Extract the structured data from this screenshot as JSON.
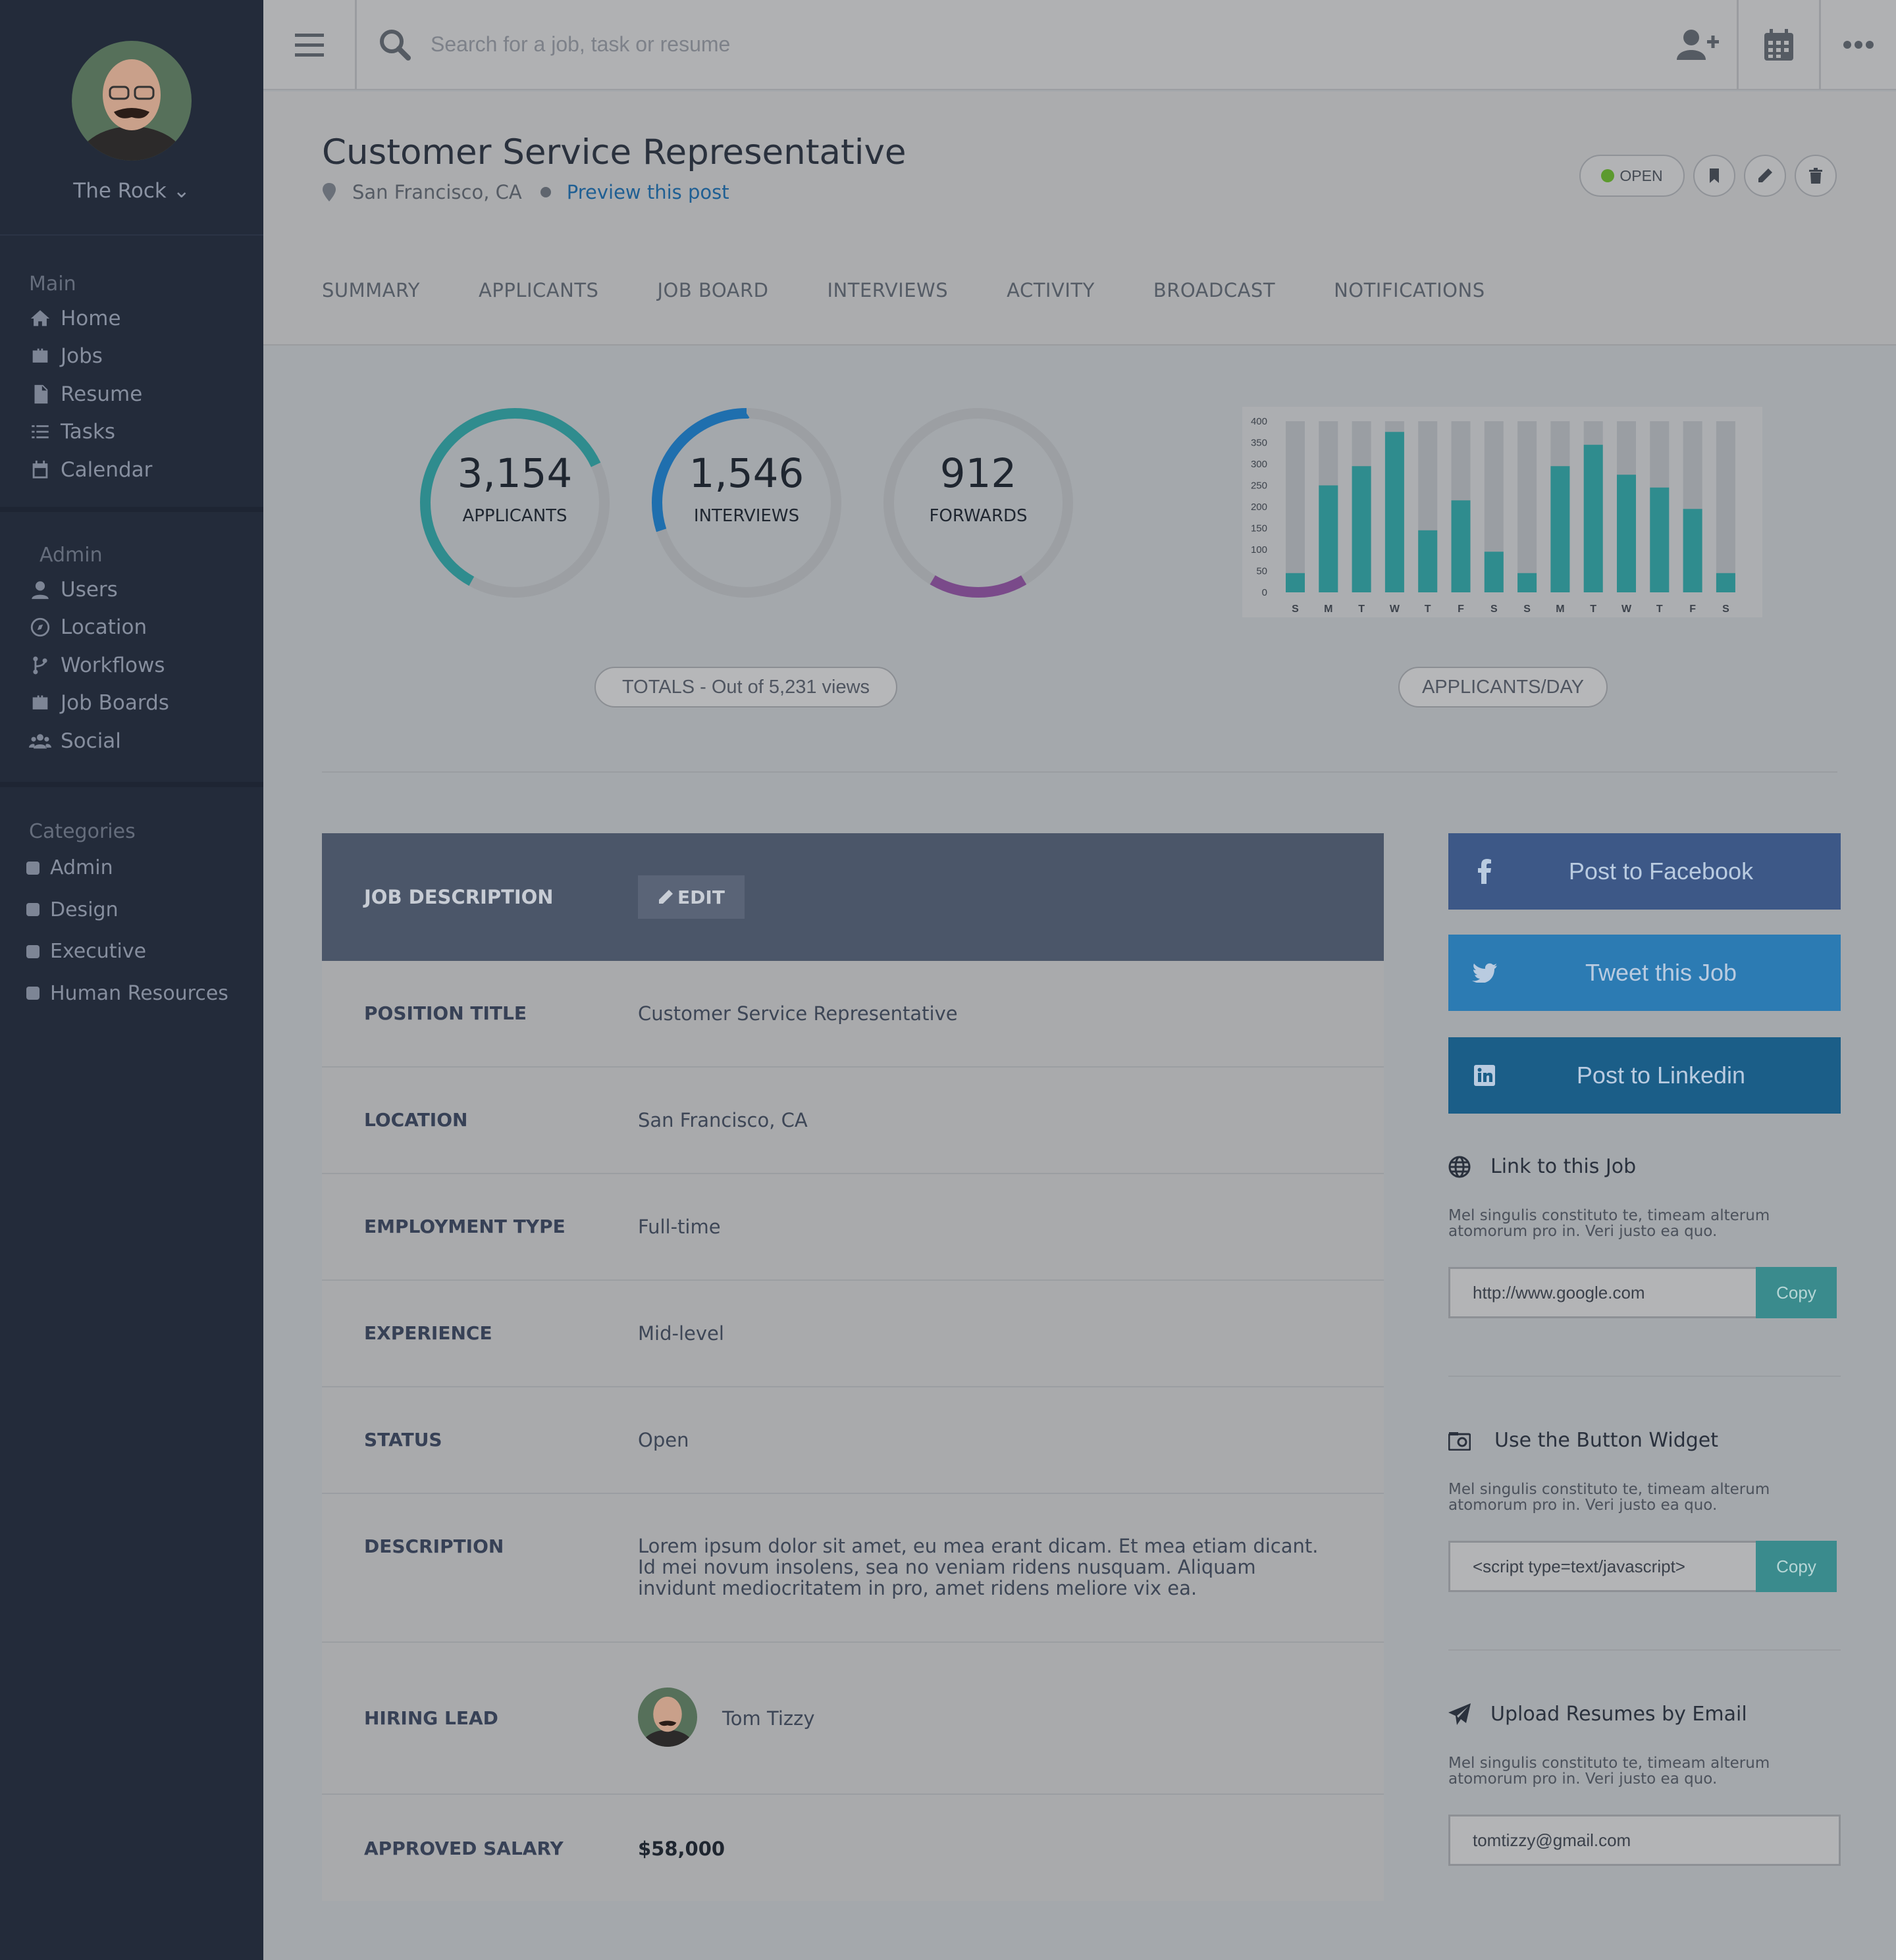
{
  "sidebar": {
    "user_name": "The Rock",
    "main_title": "Main",
    "main_items": [
      {
        "label": "Home",
        "icon": "home-icon"
      },
      {
        "label": "Jobs",
        "icon": "briefcase-icon"
      },
      {
        "label": "Resume",
        "icon": "document-icon"
      },
      {
        "label": "Tasks",
        "icon": "tasks-icon"
      },
      {
        "label": "Calendar",
        "icon": "calendar-icon"
      }
    ],
    "admin_title": "Admin",
    "admin_items": [
      {
        "label": "Users",
        "icon": "user-icon"
      },
      {
        "label": "Location",
        "icon": "compass-icon"
      },
      {
        "label": "Workflows",
        "icon": "branch-icon"
      },
      {
        "label": "Job Boards",
        "icon": "briefcase-icon"
      },
      {
        "label": "Social",
        "icon": "group-icon"
      }
    ],
    "categories_title": "Categories",
    "categories": [
      "Admin",
      "Design",
      "Executive",
      "Human Resources"
    ]
  },
  "topbar": {
    "search_placeholder": "Search for a job, task or resume"
  },
  "header": {
    "title": "Customer Service Representative",
    "location": "San Francisco, CA",
    "preview_link": "Preview this post",
    "status_label": "OPEN",
    "tabs": [
      "SUMMARY",
      "APPLICANTS",
      "JOB BOARD",
      "INTERVIEWS",
      "ACTIVITY",
      "BROADCAST",
      "NOTIFICATIONS"
    ]
  },
  "stats": {
    "rings": [
      {
        "value": "3,154",
        "label": "APPLICANTS",
        "color": "#2f8c8e",
        "fraction": 0.6
      },
      {
        "value": "1,546",
        "label": "INTERVIEWS",
        "color": "#1f6fae",
        "fraction": 0.3
      },
      {
        "value": "912",
        "label": "FORWARDS",
        "color": "#7a4a8a",
        "fraction": 0.17
      }
    ],
    "totals_label": "TOTALS - Out of 5,231 views",
    "chart_label": "APPLICANTS/DAY"
  },
  "chart_data": {
    "type": "bar",
    "categories": [
      "S",
      "M",
      "T",
      "W",
      "T",
      "F",
      "S",
      "S",
      "M",
      "T",
      "W",
      "T",
      "F",
      "S"
    ],
    "values": [
      45,
      250,
      295,
      375,
      145,
      215,
      95,
      45,
      295,
      345,
      275,
      245,
      195,
      45
    ],
    "ylim": [
      0,
      400
    ],
    "yticks": [
      0,
      50,
      100,
      150,
      200,
      250,
      300,
      350,
      400
    ],
    "bar_color": "#2f8c8e",
    "track_color": "#9a9ea3"
  },
  "job_table": {
    "header_label": "JOB DESCRIPTION",
    "edit_label": "EDIT",
    "rows": [
      {
        "key": "POSITION TITLE",
        "value": "Customer Service Representative"
      },
      {
        "key": "LOCATION",
        "value": "San Francisco, CA"
      },
      {
        "key": "EMPLOYMENT TYPE",
        "value": "Full-time"
      },
      {
        "key": "EXPERIENCE",
        "value": "Mid-level"
      },
      {
        "key": "STATUS",
        "value": "Open"
      },
      {
        "key": "DESCRIPTION",
        "value": "Lorem ipsum dolor sit amet, eu mea erant dicam. Et mea etiam dicant. Id mei novum insolens, sea no veniam ridens nusquam. Aliquam invidunt mediocritatem in pro, amet ridens meliore vix ea."
      },
      {
        "key": "HIRING LEAD",
        "value": "Tom Tizzy"
      },
      {
        "key": "APPROVED SALARY",
        "value": "$58,000"
      }
    ]
  },
  "share": {
    "facebook": "Post to Facebook",
    "twitter": "Tweet this Job",
    "linkedin": "Post to Linkedin",
    "link_title": "Link to this Job",
    "link_desc": "Mel singulis constituto te, timeam alterum atomorum pro in. Veri justo ea quo.",
    "link_value": "http://www.google.com",
    "copy_label": "Copy",
    "widget_title": "Use the Button Widget",
    "widget_desc": "Mel singulis constituto te, timeam alterum atomorum pro in. Veri justo ea quo.",
    "widget_value": "<script type=text/javascript>",
    "email_title": "Upload Resumes by Email",
    "email_desc": "Mel singulis constituto te, timeam alterum atomorum pro in. Veri justo ea quo.",
    "email_value": "tomtizzy@gmail.com"
  }
}
